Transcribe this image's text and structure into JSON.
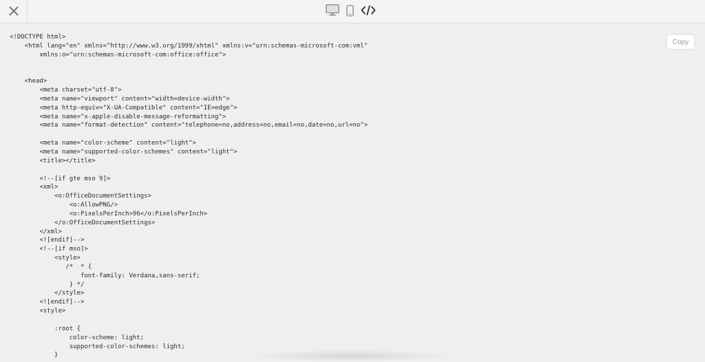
{
  "toolbar": {
    "close_icon": "close-icon",
    "view_modes": [
      {
        "name": "desktop",
        "icon": "desktop-icon"
      },
      {
        "name": "mobile",
        "icon": "mobile-icon"
      },
      {
        "name": "code",
        "icon": "code-icon",
        "active": true
      }
    ]
  },
  "code": {
    "copy_label": "Copy",
    "lines": [
      "<!DOCTYPE html>",
      "    <html lang=\"en\" xmlns=\"http://www.w3.org/1999/xhtml\" xmlns:v=\"urn:schemas-microsoft-com:vml\"",
      "        xmlns:o=\"urn:schemas-microsoft-com:office:office\">",
      "",
      "",
      "    <head>",
      "        <meta charset=\"utf-8\">",
      "        <meta name=\"viewport\" content=\"width=device-width\">",
      "        <meta http-equiv=\"X-UA-Compatible\" content=\"IE=edge\">",
      "        <meta name=\"x-apple-disable-message-reformatting\">",
      "        <meta name=\"format-detection\" content=\"telephone=no,address=no,email=no,date=no,url=no\">",
      "",
      "        <meta name=\"color-scheme\" content=\"light\">",
      "        <meta name=\"supported-color-schemes\" content=\"light\">",
      "        <title></title>",
      "",
      "        <!--[if gte mso 9]>",
      "        <xml>",
      "            <o:OfficeDocumentSettings>",
      "                <o:AllowPNG/>",
      "                <o:PixelsPerInch>96</o:PixelsPerInch>",
      "            </o:OfficeDocumentSettings>",
      "        </xml>",
      "        <![endif]-->",
      "        <!--[if mso]>",
      "            <style>",
      "               /*  * {",
      "                   font-family: Verdana,sans-serif;",
      "                } */",
      "            </style>",
      "        <![endif]-->",
      "        <style>",
      "",
      "            :root {",
      "                color-scheme: light;",
      "                supported-color-schemes: light;",
      "            }"
    ]
  }
}
